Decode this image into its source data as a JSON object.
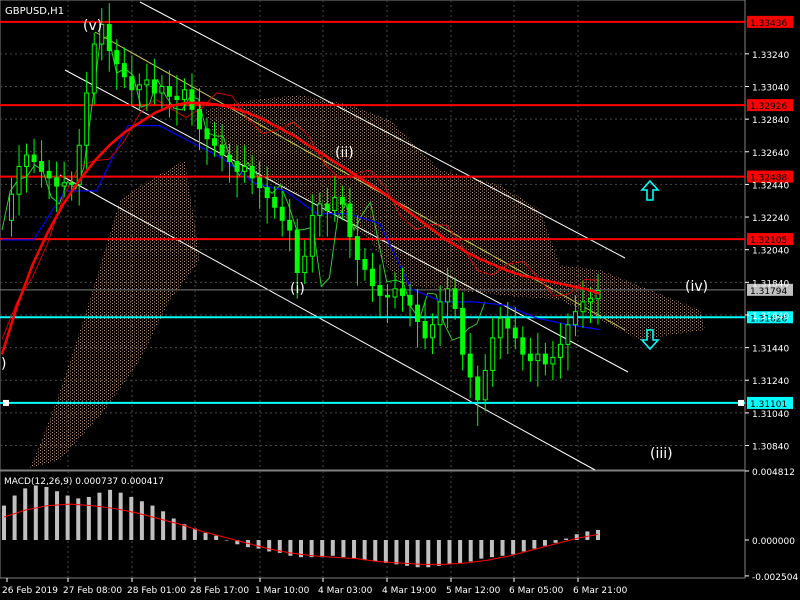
{
  "chart_data": {
    "type": "line",
    "title": "GBPUSD,H1",
    "price_axis": {
      "ylim": [
        1.3069,
        1.3357
      ],
      "ticks": [
        "1.33240",
        "1.33040",
        "1.32840",
        "1.32640",
        "1.32440",
        "1.32240",
        "1.32040",
        "1.31840",
        "1.31640",
        "1.31440",
        "1.31240",
        "1.31040",
        "1.30840"
      ],
      "tick_values": [
        1.3324,
        1.3304,
        1.3284,
        1.3264,
        1.3244,
        1.3224,
        1.3204,
        1.3184,
        1.3164,
        1.3144,
        1.3124,
        1.3104,
        1.3084
      ]
    },
    "x_labels": [
      "26 Feb 2019",
      "27 Feb 08:00",
      "28 Feb 01:00",
      "28 Feb 17:00",
      "1 Mar 10:00",
      "4 Mar 03:00",
      "4 Mar 19:00",
      "5 Mar 12:00",
      "6 Mar 05:00",
      "6 Mar 21:00"
    ],
    "horizontal_levels": [
      {
        "value": 1.33436,
        "label": "1.33436",
        "color": "#ff0000",
        "label_bg": "#ff0000"
      },
      {
        "value": 1.32926,
        "label": "1.32926",
        "color": "#ff0000",
        "label_bg": "#ff0000"
      },
      {
        "value": 1.32488,
        "label": "1.32488",
        "color": "#ff0000",
        "label_bg": "#ff0000"
      },
      {
        "value": 1.32105,
        "label": "1.32105",
        "color": "#ff0000",
        "label_bg": "#ff0000"
      },
      {
        "value": 1.31794,
        "label": "1.31794",
        "color": "#808080",
        "label_bg": "#c0c0c0"
      },
      {
        "value": 1.31626,
        "label": "1.31626",
        "color": "#00ffff",
        "label_bg": "#00ffff"
      },
      {
        "value": 1.31101,
        "label": "1.31101",
        "color": "#00ffff",
        "label_bg": "#00ffff"
      }
    ],
    "wave_labels": [
      "(v)",
      "(ii)",
      "(i)",
      "(iv)",
      "(iii)",
      ")"
    ],
    "price_series": [
      1.3222,
      1.3238,
      1.3255,
      1.3262,
      1.3258,
      1.3252,
      1.3248,
      1.3243,
      1.3245,
      1.3244,
      1.3268,
      1.33,
      1.333,
      1.3342,
      1.3326,
      1.3318,
      1.331,
      1.3302,
      1.3305,
      1.3308,
      1.33,
      1.3304,
      1.3298,
      1.3296,
      1.3302,
      1.329,
      1.3278,
      1.3272,
      1.3268,
      1.3262,
      1.3258,
      1.3252,
      1.3255,
      1.3248,
      1.3242,
      1.3236,
      1.323,
      1.3222,
      1.3216,
      1.319,
      1.32,
      1.3225,
      1.3232,
      1.3228,
      1.3236,
      1.3232,
      1.3212,
      1.3198,
      1.3192,
      1.3182,
      1.3176,
      1.3175,
      1.318,
      1.3176,
      1.317,
      1.316,
      1.315,
      1.3158,
      1.3172,
      1.318,
      1.3168,
      1.314,
      1.3126,
      1.3112,
      1.313,
      1.315,
      1.3162,
      1.3156,
      1.315,
      1.314,
      1.3136,
      1.314,
      1.3134,
      1.3138,
      1.3146,
      1.3158,
      1.3166,
      1.3172,
      1.3174,
      1.3179
    ],
    "red_ma": [
      1.314,
      1.317,
      1.3195,
      1.3215,
      1.3232,
      1.3246,
      1.3258,
      1.3268,
      1.3276,
      1.3282,
      1.3288,
      1.3292,
      1.3294,
      1.3294,
      1.3293,
      1.3291,
      1.3288,
      1.3284,
      1.3279,
      1.3274,
      1.3268,
      1.3262,
      1.3256,
      1.325,
      1.3244,
      1.3238,
      1.3231,
      1.3224,
      1.3217,
      1.321,
      1.3204,
      1.3199,
      1.3195,
      1.3191,
      1.3188,
      1.3186,
      1.3184,
      1.3182,
      1.318,
      1.3177
    ],
    "blue_line": [
      1.321,
      1.321,
      1.324,
      1.324,
      1.328,
      1.328,
      1.327,
      1.326,
      1.3245,
      1.324,
      1.3226,
      1.3226,
      1.322,
      1.318,
      1.3172,
      1.3172,
      1.317,
      1.3162,
      1.3158,
      1.3155
    ],
    "macd": {
      "label": "MACD(12,26,9) 0.000737 0.000417",
      "ylim": [
        -0.00265,
        0.00481
      ],
      "ticks": [
        "0.004812",
        "0.000000",
        "-0.002504"
      ],
      "tick_values": [
        0.004812,
        0.0,
        -0.002504
      ],
      "histogram": [
        0.0024,
        0.0031,
        0.0036,
        0.0038,
        0.0037,
        0.0034,
        0.0031,
        0.0029,
        0.003,
        0.0033,
        0.0035,
        0.0033,
        0.003,
        0.0027,
        0.0024,
        0.002,
        0.0015,
        0.0011,
        0.0008,
        0.0005,
        0.0003,
        0.0,
        -0.0003,
        -0.0005,
        -0.0006,
        -0.0008,
        -0.0009,
        -0.0011,
        -0.0012,
        -0.0012,
        -0.0012,
        -0.0011,
        -0.0012,
        -0.0013,
        -0.0014,
        -0.0015,
        -0.0016,
        -0.0017,
        -0.0018,
        -0.0019,
        -0.0019,
        -0.0018,
        -0.0017,
        -0.0016,
        -0.0015,
        -0.0013,
        -0.0012,
        -0.0011,
        -0.001,
        -0.0008,
        -0.0006,
        -0.0004,
        -0.0002,
        0.0001,
        0.0004,
        0.0006,
        0.0007
      ],
      "signal": [
        0.0016,
        0.0021,
        0.0024,
        0.0025,
        0.0024,
        0.0022,
        0.0019,
        0.0015,
        0.0011,
        0.0006,
        0.0002,
        -0.0002,
        -0.0006,
        -0.0009,
        -0.0011,
        -0.0012,
        -0.0013,
        -0.0015,
        -0.0016,
        -0.0017,
        -0.0017,
        -0.0016,
        -0.0014,
        -0.0011,
        -0.0007,
        -0.0003,
        0.0001,
        0.0004
      ]
    },
    "colors": {
      "background": "#000000",
      "grid": "#4a4a4a",
      "candles": "#00ff00",
      "lagging_line": "#2ecc2e",
      "red_ma": "#ff0000",
      "red_thin": "#cc0000",
      "blue_line": "#0000ff",
      "channel": "#ffffff",
      "yellow_channel": "#c8c850",
      "cloud": "#d9a77d",
      "macd_hist": "#c0c0c0",
      "macd_signal": "#ff0000",
      "arrow": "#00ffff"
    }
  }
}
